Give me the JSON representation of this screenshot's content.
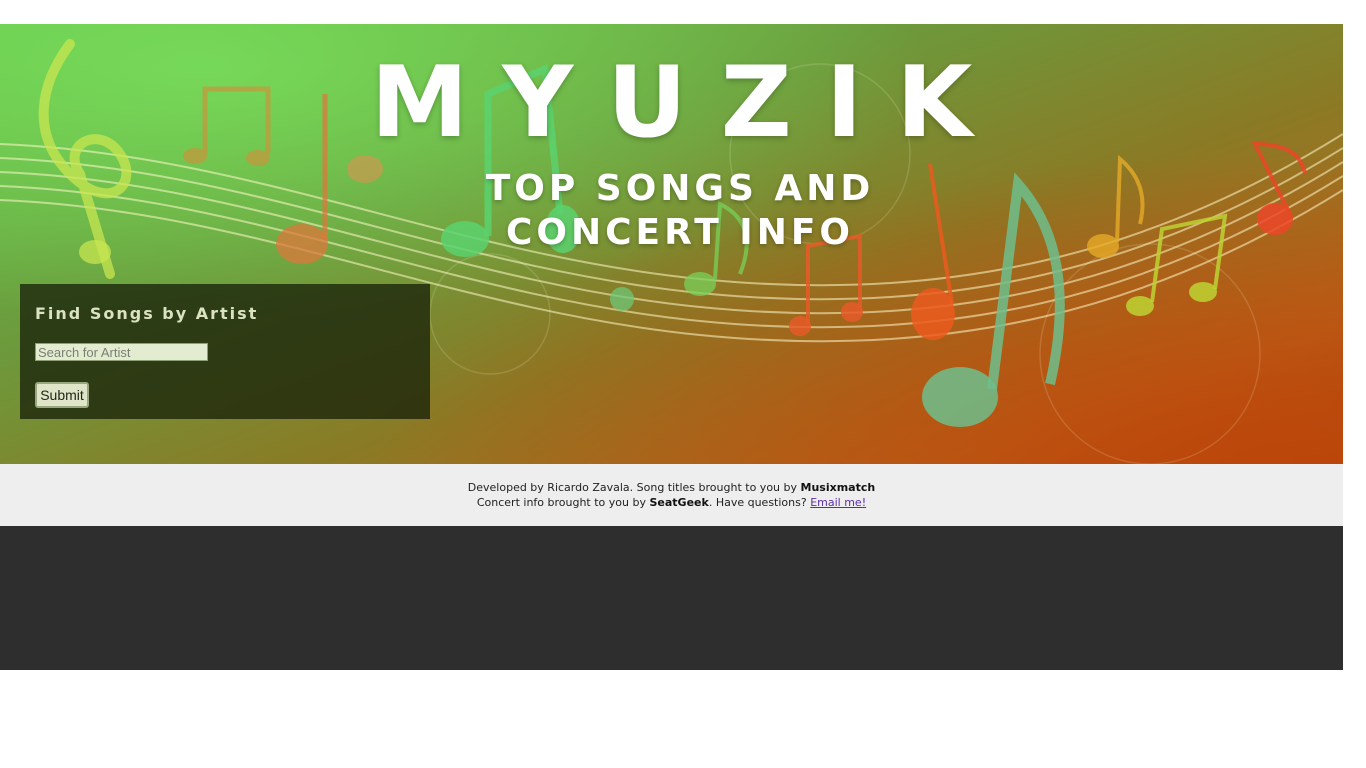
{
  "header": {
    "title": "MYUZIK",
    "subtitle": "TOP SONGS AND CONCERT INFO"
  },
  "search": {
    "heading": "Find Songs by Artist",
    "placeholder": "Search for Artist",
    "submit_label": "Submit"
  },
  "credits": {
    "line1_prefix": "Developed by Ricardo Zavala. Song titles brought to you by",
    "song_source": "Musixmatch",
    "line2_prefix": "Concert info brought to you by",
    "concert_source": "SeatGeek",
    "line2_suffix": ". Have questions?",
    "contact_link": "Email me!"
  },
  "colors": {
    "footer_dark": "#2e2e2e",
    "credits_bg": "#eeeeee",
    "link": "#5b2ea6",
    "panel": "#19230a"
  },
  "icons": {
    "hero_decor": "music-notes-icon"
  }
}
